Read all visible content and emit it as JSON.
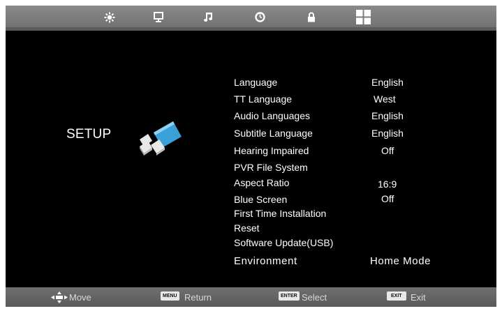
{
  "top_tabs": [
    {
      "name": "picture-icon"
    },
    {
      "name": "channel-icon"
    },
    {
      "name": "sound-icon"
    },
    {
      "name": "time-icon"
    },
    {
      "name": "lock-icon"
    },
    {
      "name": "setup-icon"
    }
  ],
  "page": {
    "title": "SETUP"
  },
  "menu": [
    {
      "label": "Language",
      "value": "English"
    },
    {
      "label": "TT Language",
      "value": "West"
    },
    {
      "label": "Audio Languages",
      "value": "English"
    },
    {
      "label": "Subtitle Language",
      "value": "English"
    },
    {
      "label": "Hearing Impaired",
      "value": "Off"
    },
    {
      "label": "PVR File System",
      "value": ""
    },
    {
      "label": "Aspect Ratio",
      "value": "16:9"
    },
    {
      "label": "Blue Screen",
      "value": "Off"
    },
    {
      "label": "First Time Installation",
      "value": ""
    },
    {
      "label": "Reset",
      "value": ""
    },
    {
      "label": "Software Update(USB)",
      "value": ""
    },
    {
      "label": "Environment",
      "value": "Home Mode"
    }
  ],
  "hints": {
    "move": "Move",
    "menu_key": "MENU",
    "return": "Return",
    "enter_key": "ENTER",
    "select": "Select",
    "exit_key": "EXIT",
    "exit": "Exit"
  },
  "colors": {
    "background": "#000000",
    "bar": "#6e6e6e",
    "text": "#ffffff",
    "logo_blue": "#3aa0d8"
  }
}
